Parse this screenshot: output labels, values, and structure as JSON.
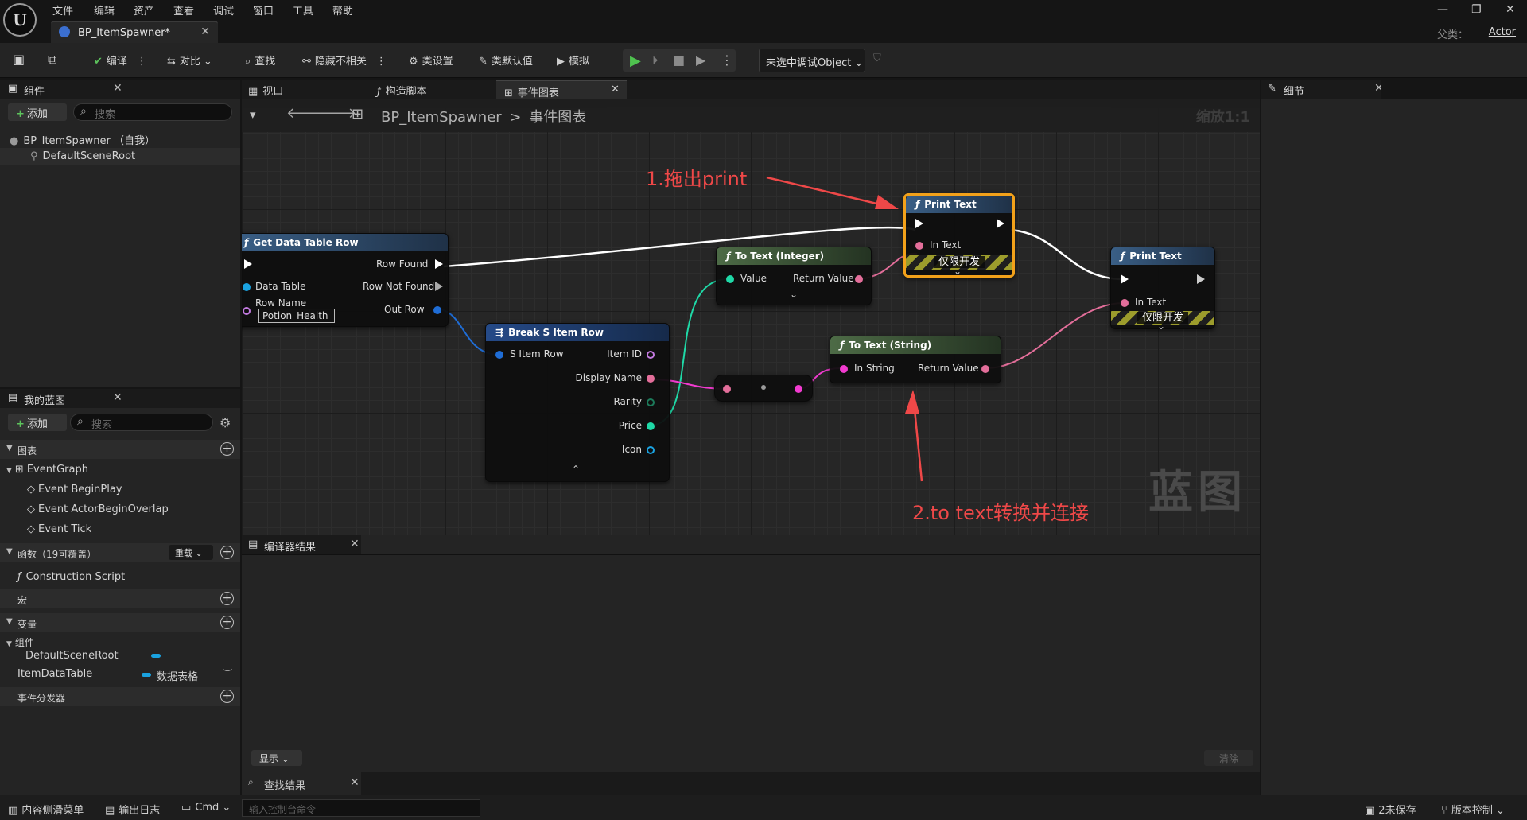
{
  "menu": [
    "文件",
    "编辑",
    "资产",
    "查看",
    "调试",
    "窗口",
    "工具",
    "帮助"
  ],
  "doc_tab": {
    "title": "BP_ItemSpawner*"
  },
  "parent": {
    "label": "父类：",
    "value": "Actor"
  },
  "toolbar": {
    "compile": "编译",
    "diff": "对比",
    "find": "查找",
    "hide_unrelated": "隐藏不相关",
    "class_settings": "类设置",
    "class_defaults": "类默认值",
    "simulate": "模拟",
    "debug_object": "未选中调试Object"
  },
  "components": {
    "title": "组件",
    "add": "添加",
    "search_placeholder": "搜索",
    "items": [
      "BP_ItemSpawner （自我）",
      "DefaultSceneRoot"
    ]
  },
  "my_blueprint": {
    "title": "我的蓝图",
    "add": "添加",
    "search_placeholder": "搜索",
    "graphs_label": "图表",
    "event_graph": "EventGraph",
    "events": [
      "Event BeginPlay",
      "Event ActorBeginOverlap",
      "Event Tick"
    ],
    "functions_label": "函数（19可覆盖）",
    "override": "重载",
    "construction": "Construction Script",
    "macros_label": "宏",
    "variables_label": "变量",
    "components_label": "组件",
    "vars": [
      {
        "name": "DefaultSceneRoot",
        "type": ""
      },
      {
        "name": "ItemDataTable",
        "type": "数据表格"
      }
    ],
    "dispatchers_label": "事件分发器"
  },
  "editor_tabs": [
    "视口",
    "构造脚本",
    "事件图表"
  ],
  "breadcrumb": {
    "bp": "BP_ItemSpawner",
    "sep": ">",
    "graph": "事件图表",
    "zoom": "缩放1:1"
  },
  "nodes": {
    "get_row": {
      "title": "Get Data Table Row",
      "row_found": "Row Found",
      "data_table": "Data Table",
      "row_not_found": "Row Not Found",
      "row_name": "Row Name",
      "row_name_value": "Potion_Health",
      "out_row": "Out Row"
    },
    "break_row": {
      "title": "Break S Item Row",
      "in": "S Item Row",
      "outs": [
        "Item ID",
        "Display Name",
        "Rarity",
        "Price",
        "Icon"
      ]
    },
    "to_text_int": {
      "title": "To Text (Integer)",
      "in": "Value",
      "out": "Return Value"
    },
    "to_text_str": {
      "title": "To Text (String)",
      "in": "In String",
      "out": "Return Value"
    },
    "print1": {
      "title": "Print Text",
      "in": "In Text",
      "dev": "仅限开发"
    },
    "print2": {
      "title": "Print Text",
      "in": "In Text",
      "dev": "仅限开发"
    }
  },
  "annotations": {
    "a1": "1.拖出print",
    "a2": "2.to text转换并连接"
  },
  "watermark": "蓝图",
  "compiler": {
    "title": "编译器结果",
    "show": "显示",
    "clear": "清除"
  },
  "find_results": {
    "title": "查找结果"
  },
  "details": {
    "title": "细节"
  },
  "statusbar": {
    "content_drawer": "内容侧滑菜单",
    "output_log": "输出日志",
    "cmd": "Cmd",
    "console_placeholder": "输入控制台命令",
    "unsaved": "2未保存",
    "source_control": "版本控制"
  },
  "colors": {
    "exec": "#ffffff",
    "text_pin": "#e36e9a",
    "int_pin": "#1fd9a7",
    "string_pin": "#f23bd0",
    "struct_pin": "#1f6dd6",
    "object_pin": "#1aa2e0",
    "name_pin": "#c37ae0",
    "highlight": "#f2a11a"
  }
}
